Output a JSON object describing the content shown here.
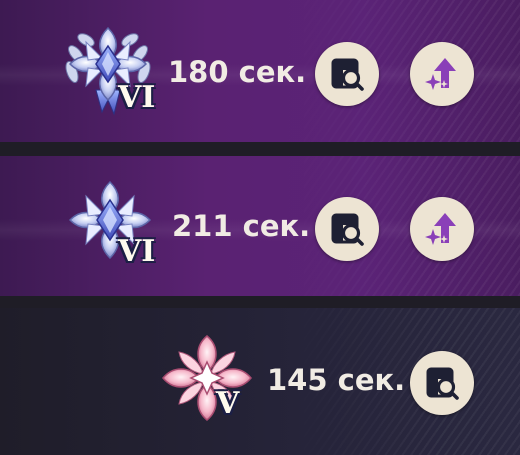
{
  "entries": [
    {
      "rank": "VI",
      "time": "180 сек.",
      "badge_type": "silver-crystal-laurel-badge",
      "actions": [
        "view-button",
        "upgrade-button"
      ]
    },
    {
      "rank": "VI",
      "time": "211 сек.",
      "badge_type": "silver-crystal-badge",
      "actions": [
        "view-button",
        "upgrade-button"
      ]
    },
    {
      "rank": "V",
      "time": "145 сек.",
      "badge_type": "pink-crystal-badge",
      "actions": [
        "view-button"
      ]
    }
  ],
  "colors": {
    "row_purple": "#5a2272",
    "row_dark": "#26243a",
    "button_bg": "#ede4d3",
    "view_icon": "#1e2033",
    "upgrade_icon": "#8a3fb8",
    "text": "#f1ece4"
  },
  "icons": {
    "view": "magnifier-page-icon",
    "upgrade": "up-arrow-sparkle-icon"
  }
}
